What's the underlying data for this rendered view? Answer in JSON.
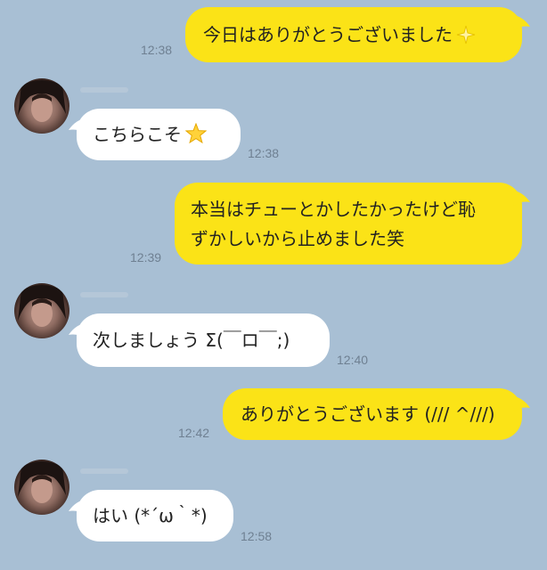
{
  "messages": [
    {
      "id": "m1",
      "direction": "outgoing",
      "text": "今日はありがとうございました",
      "emoji": "sparkle-icon",
      "time": "12:38"
    },
    {
      "id": "m2",
      "direction": "incoming",
      "text": "こちらこそ",
      "emoji": "star-icon",
      "time": "12:38"
    },
    {
      "id": "m3",
      "direction": "outgoing",
      "lines": [
        "本当はチューとかしたかったけど恥",
        "ずかしいから止めました笑"
      ],
      "time": "12:39"
    },
    {
      "id": "m4",
      "direction": "incoming",
      "text": "次しましょう Σ(￣ロ￣;)",
      "time": "12:40"
    },
    {
      "id": "m5",
      "direction": "outgoing",
      "text": "ありがとうございます (/// ^///)",
      "time": "12:42"
    },
    {
      "id": "m6",
      "direction": "incoming",
      "text": "はい (*´ω｀*)",
      "time": "12:58"
    }
  ],
  "colors": {
    "background": "#a8bfd4",
    "outgoing_bubble": "#fbe317",
    "incoming_bubble": "#ffffff",
    "timestamp": "#6f8092"
  }
}
